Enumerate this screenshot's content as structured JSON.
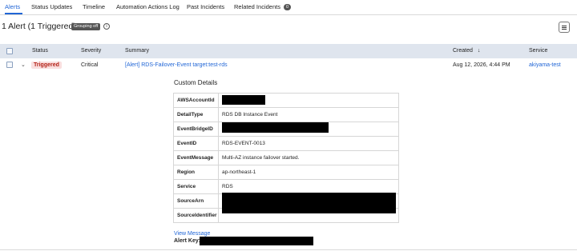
{
  "tabs": [
    {
      "label": "Alerts"
    },
    {
      "label": "Status Updates"
    },
    {
      "label": "Timeline"
    },
    {
      "label": "Automation Actions Log"
    },
    {
      "label": "Past Incidents"
    },
    {
      "label": "Related Incidents",
      "count": "0"
    }
  ],
  "header": {
    "title": "1 Alert (1 Triggered)",
    "grouping_badge": "Grouping off",
    "info_icon": "i"
  },
  "table": {
    "columns": {
      "status": "Status",
      "severity": "Severity",
      "summary": "Summary",
      "created": "Created",
      "created_sort": "↓",
      "service": "Service"
    },
    "row": {
      "expand_icon": "⌄",
      "status": "Triggered",
      "severity": "Critical",
      "summary": "[Alert] RDS-Failover-Event target:test-rds",
      "created": "Aug 12, 2026, 4:44 PM",
      "service": "akiyama-test"
    }
  },
  "custom_details": {
    "title": "Custom Details",
    "rows": [
      {
        "key": "AWSAccountId",
        "value": ""
      },
      {
        "key": "DetailType",
        "value": "RDS DB Instance Event"
      },
      {
        "key": "EventBridgeID",
        "value": ""
      },
      {
        "key": "EventID",
        "value": "RDS-EVENT-0013"
      },
      {
        "key": "EventMessage",
        "value": "Multi-AZ instance failover started."
      },
      {
        "key": "Region",
        "value": "ap-northeast-1"
      },
      {
        "key": "Service",
        "value": "RDS"
      },
      {
        "key": "SourceArn",
        "value": ""
      },
      {
        "key": "SourceIdentifier",
        "value": ""
      }
    ]
  },
  "footer": {
    "view_message": "View Message",
    "alert_key_label": "Alert Key:"
  },
  "colors": {
    "accent": "#2166d6",
    "triggered_bg": "#f9dede",
    "triggered_text": "#b42318",
    "header_bg": "#dfe5ee"
  }
}
